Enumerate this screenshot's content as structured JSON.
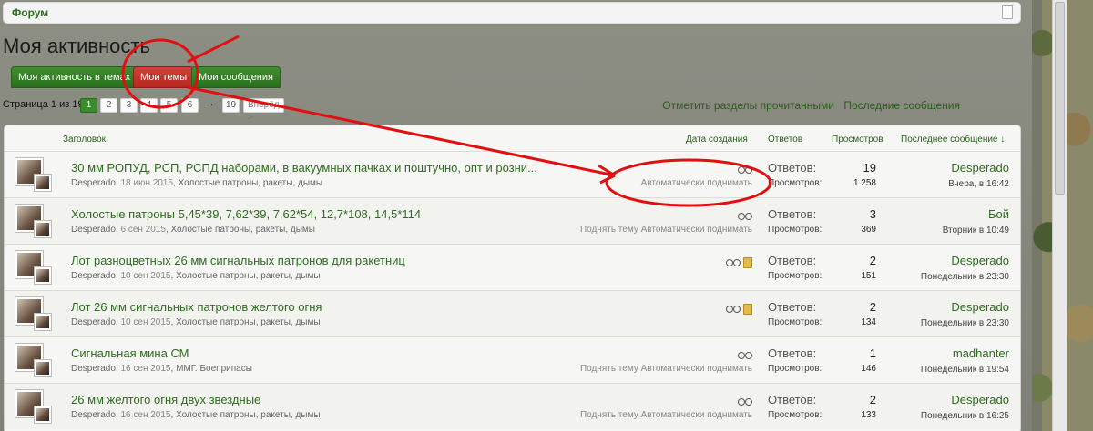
{
  "breadcrumb": {
    "forum": "Форум"
  },
  "page_title": "Моя активность",
  "tabs": [
    {
      "label": "Моя активность в темах"
    },
    {
      "label": "Мои темы"
    },
    {
      "label": "Мои сообщения"
    }
  ],
  "pager": {
    "label": "Страница 1 из 19",
    "pages": [
      "1",
      "2",
      "3",
      "4",
      "5",
      "6"
    ],
    "arrow": "→",
    "last": "19",
    "next": "Вперёд >"
  },
  "toplinks": {
    "mark_read": "Отметить разделы прочитанными",
    "recent": "Последние сообщения"
  },
  "table": {
    "headers": {
      "title": "Заголовок",
      "created": "Дата создания",
      "replies": "Ответов",
      "views": "Просмотров",
      "last": "Последнее сообщение ↓"
    },
    "rows": [
      {
        "title": "30 мм РОПУД, РСП, РСПД наборами, в вакуумных пачках и поштучно, опт и розни...",
        "author": "Desperado",
        "date": "18 июн 2015",
        "forum": "Холостые патроны, ракеты, дымы",
        "actions": "Автоматически поднимать",
        "replies_label": "Ответов:",
        "views_label": "Просмотров:",
        "replies": "19",
        "views": "1.258",
        "last_user": "Desperado",
        "last_date": "Вчера, в 16:42"
      },
      {
        "title": "Холостые патроны 5,45*39, 7,62*39, 7,62*54, 12,7*108, 14,5*114",
        "author": "Desperado",
        "date": "6 сен 2015",
        "forum": "Холостые патроны, ракеты, дымы",
        "actions": "Поднять тему Автоматически поднимать",
        "replies_label": "Ответов:",
        "views_label": "Просмотров:",
        "replies": "3",
        "views": "369",
        "last_user": "Бой",
        "last_date": "Вторник в 10:49"
      },
      {
        "title": "Лот разноцветных 26 мм сигнальных патронов для ракетниц",
        "author": "Desperado",
        "date": "10 сен 2015",
        "forum": "Холостые патроны, ракеты, дымы",
        "actions": "",
        "replies_label": "Ответов:",
        "views_label": "Просмотров:",
        "replies": "2",
        "views": "151",
        "last_user": "Desperado",
        "last_date": "Понедельник в 23:30"
      },
      {
        "title": "Лот 26 мм сигнальных патронов желтого огня",
        "author": "Desperado",
        "date": "10 сен 2015",
        "forum": "Холостые патроны, ракеты, дымы",
        "actions": "",
        "replies_label": "Ответов:",
        "views_label": "Просмотров:",
        "replies": "2",
        "views": "134",
        "last_user": "Desperado",
        "last_date": "Понедельник в 23:30"
      },
      {
        "title": "Сигнальная мина СМ",
        "author": "Desperado",
        "date": "16 сен 2015",
        "forum": "ММГ. Боеприпасы",
        "actions": "Поднять тему Автоматически поднимать",
        "replies_label": "Ответов:",
        "views_label": "Просмотров:",
        "replies": "1",
        "views": "146",
        "last_user": "madhanter",
        "last_date": "Понедельник в 19:54"
      },
      {
        "title": "26 мм желтого огня двух звездные",
        "author": "Desperado",
        "date": "16 сен 2015",
        "forum": "Холостые патроны, ракеты, дымы",
        "actions": "Поднять тему Автоматически поднимать",
        "replies_label": "Ответов:",
        "views_label": "Просмотров:",
        "replies": "2",
        "views": "133",
        "last_user": "Desperado",
        "last_date": "Понедельник в 16:25"
      }
    ]
  },
  "colors": {
    "link_green": "#2e6c1f",
    "tab_green": "#2a6f1e",
    "tab_active_red": "#b7281f",
    "annotation_red": "#e11010"
  }
}
